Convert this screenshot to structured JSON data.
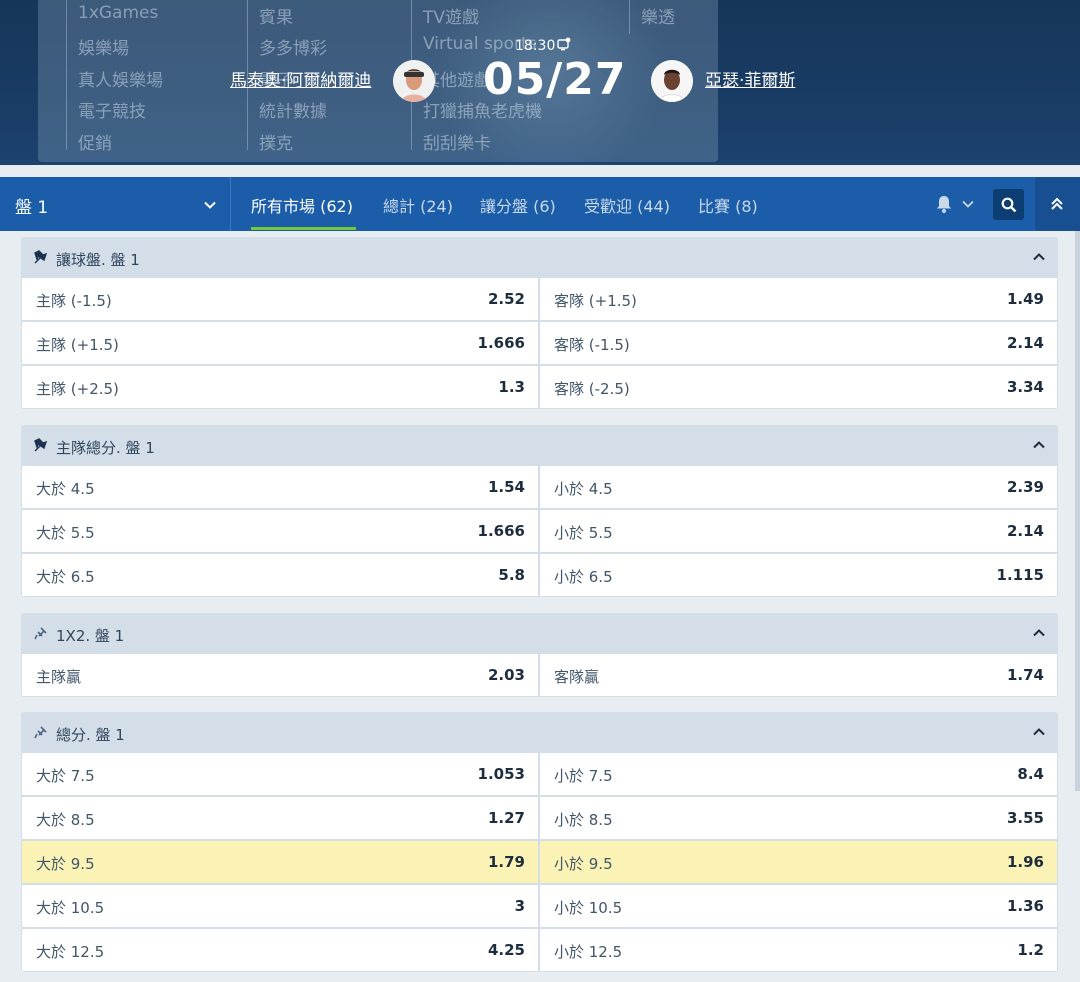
{
  "menu": {
    "col1": [
      "1xGames",
      "娛樂場",
      "真人娛樂場",
      "電子競技",
      "促銷"
    ],
    "col2": [
      "賓果",
      "多多博彩",
      "電子",
      "統計數據",
      "撲克"
    ],
    "col3": [
      "TV遊戲",
      "Virtual sports",
      "其他遊戲",
      "打獵捕魚老虎機",
      "刮刮樂卡"
    ],
    "col4": [
      "樂透"
    ]
  },
  "match": {
    "home_team": "馬泰奧·阿爾納爾迪",
    "away_team": "亞瑟·菲爾斯",
    "time": "18:30",
    "date": "05/27"
  },
  "bar": {
    "period": "盤 1",
    "tabs": [
      {
        "label": "所有市場 (62)",
        "active": true
      },
      {
        "label": "總計 (24)",
        "active": false
      },
      {
        "label": "讓分盤 (6)",
        "active": false
      },
      {
        "label": "受歡迎 (44)",
        "active": false
      },
      {
        "label": "比賽 (8)",
        "active": false
      }
    ]
  },
  "groups": [
    {
      "title": "讓球盤. 盤 1",
      "pinned": true,
      "rows": [
        {
          "left": {
            "label": "主隊 (-1.5)",
            "odds": "2.52"
          },
          "right": {
            "label": "客隊 (+1.5)",
            "odds": "1.49"
          }
        },
        {
          "left": {
            "label": "主隊 (+1.5)",
            "odds": "1.666"
          },
          "right": {
            "label": "客隊 (-1.5)",
            "odds": "2.14"
          }
        },
        {
          "left": {
            "label": "主隊 (+2.5)",
            "odds": "1.3"
          },
          "right": {
            "label": "客隊 (-2.5)",
            "odds": "3.34"
          }
        }
      ]
    },
    {
      "title": "主隊總分. 盤 1",
      "pinned": true,
      "rows": [
        {
          "left": {
            "label": "大於 4.5",
            "odds": "1.54"
          },
          "right": {
            "label": "小於 4.5",
            "odds": "2.39"
          }
        },
        {
          "left": {
            "label": "大於 5.5",
            "odds": "1.666"
          },
          "right": {
            "label": "小於 5.5",
            "odds": "2.14"
          }
        },
        {
          "left": {
            "label": "大於 6.5",
            "odds": "5.8"
          },
          "right": {
            "label": "小於 6.5",
            "odds": "1.115"
          }
        }
      ]
    },
    {
      "title": "1X2. 盤 1",
      "pinned": false,
      "rows": [
        {
          "left": {
            "label": "主隊贏",
            "odds": "2.03"
          },
          "right": {
            "label": "客隊贏",
            "odds": "1.74"
          }
        }
      ]
    },
    {
      "title": "總分. 盤 1",
      "pinned": false,
      "rows": [
        {
          "left": {
            "label": "大於 7.5",
            "odds": "1.053"
          },
          "right": {
            "label": "小於 7.5",
            "odds": "8.4"
          }
        },
        {
          "left": {
            "label": "大於 8.5",
            "odds": "1.27"
          },
          "right": {
            "label": "小於 8.5",
            "odds": "3.55"
          }
        },
        {
          "left": {
            "label": "大於 9.5",
            "odds": "1.79"
          },
          "right": {
            "label": "小於 9.5",
            "odds": "1.96"
          },
          "highlighted": true
        },
        {
          "left": {
            "label": "大於 10.5",
            "odds": "3"
          },
          "right": {
            "label": "小於 10.5",
            "odds": "1.36"
          }
        },
        {
          "left": {
            "label": "大於 12.5",
            "odds": "4.25"
          },
          "right": {
            "label": "小於 12.5",
            "odds": "1.2"
          }
        }
      ]
    }
  ]
}
